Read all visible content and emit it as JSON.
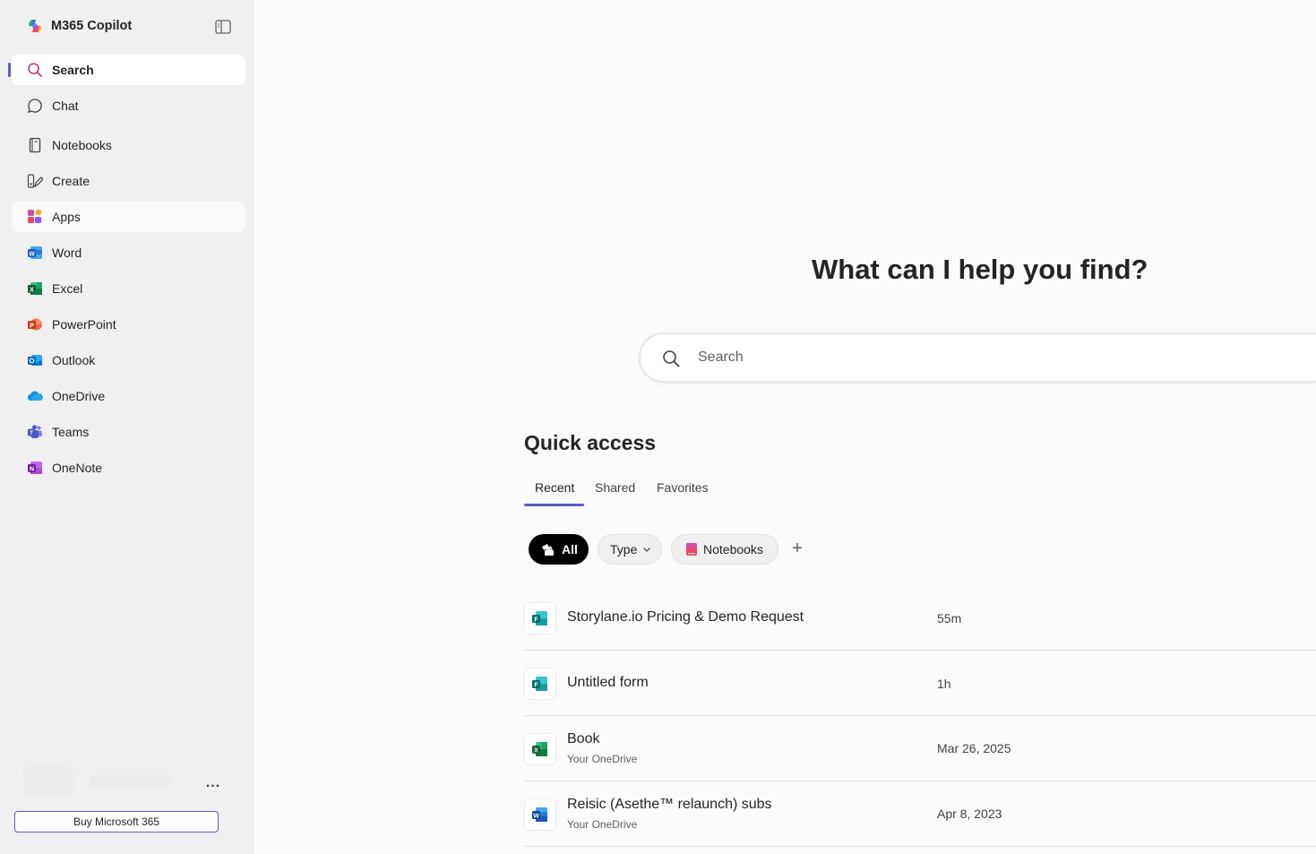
{
  "app": {
    "title": "M365 Copilot"
  },
  "sidebar": {
    "items": [
      {
        "label": "Search",
        "icon": "search-icon"
      },
      {
        "label": "Chat",
        "icon": "chat-icon"
      },
      {
        "label": "Notebooks",
        "icon": "notebook-icon"
      },
      {
        "label": "Create",
        "icon": "create-icon"
      },
      {
        "label": "Apps",
        "icon": "apps-icon"
      },
      {
        "label": "Word",
        "icon": "word-icon"
      },
      {
        "label": "Excel",
        "icon": "excel-icon"
      },
      {
        "label": "PowerPoint",
        "icon": "powerpoint-icon"
      },
      {
        "label": "Outlook",
        "icon": "outlook-icon"
      },
      {
        "label": "OneDrive",
        "icon": "onedrive-icon"
      },
      {
        "label": "Teams",
        "icon": "teams-icon"
      },
      {
        "label": "OneNote",
        "icon": "onenote-icon"
      }
    ],
    "more_label": "...",
    "buy_label": "Buy Microsoft 365"
  },
  "main": {
    "title": "What can I help you find?",
    "search": {
      "placeholder": "Search"
    },
    "quick_access": {
      "title": "Quick access",
      "tabs": [
        {
          "label": "Recent"
        },
        {
          "label": "Shared"
        },
        {
          "label": "Favorites"
        }
      ],
      "filters": {
        "all": "All",
        "type": "Type",
        "notebooks": "Notebooks",
        "add": "+"
      },
      "files": [
        {
          "name": "Storylane.io Pricing & Demo Request",
          "location": "",
          "time": "55m",
          "icon": "forms-icon"
        },
        {
          "name": "Untitled form",
          "location": "",
          "time": "1h",
          "icon": "forms-icon"
        },
        {
          "name": "Book",
          "location": "Your OneDrive",
          "time": "Mar 26, 2025",
          "icon": "excel-icon"
        },
        {
          "name": "Reisic (Asethe™ relaunch) subs",
          "location": "Your OneDrive",
          "time": "Apr 8, 2023",
          "icon": "word-icon"
        }
      ]
    }
  },
  "colors": {
    "accent": "#5b5fc7",
    "sidebar_bg": "#f0f0f0",
    "page_bg": "#fafafa"
  }
}
